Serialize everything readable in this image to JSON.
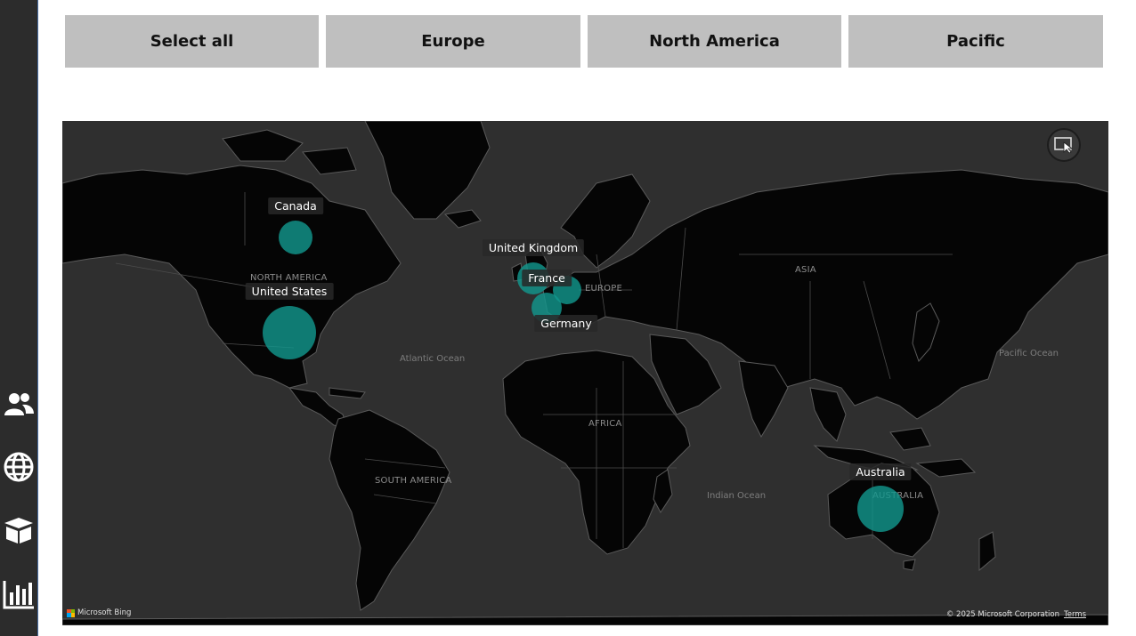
{
  "slicers": {
    "select_all": "Select all",
    "europe": "Europe",
    "north_america": "North America",
    "pacific": "Pacific"
  },
  "sidebar": {
    "items": [
      {
        "icon": "users-icon"
      },
      {
        "icon": "globe-icon"
      },
      {
        "icon": "box-icon"
      },
      {
        "icon": "bar-chart-icon"
      }
    ]
  },
  "map": {
    "region_labels": {
      "north_america": "NORTH AMERICA",
      "south_america": "SOUTH AMERICA",
      "europe": "EUROPE",
      "asia": "ASIA",
      "africa": "AFRICA",
      "australia": "AUSTRALIA"
    },
    "ocean_labels": {
      "atlantic": "Atlantic Ocean",
      "indian": "Indian Ocean",
      "pacific": "Pacific Ocean"
    },
    "countries": {
      "canada": "Canada",
      "united_states": "United States",
      "united_kingdom": "United Kingdom",
      "france": "France",
      "germany": "Germany",
      "australia": "Australia"
    },
    "bubble_color": "#12968c",
    "attribution": "Microsoft Bing",
    "copyright": "© 2025 Microsoft Corporation",
    "terms": "Terms"
  }
}
